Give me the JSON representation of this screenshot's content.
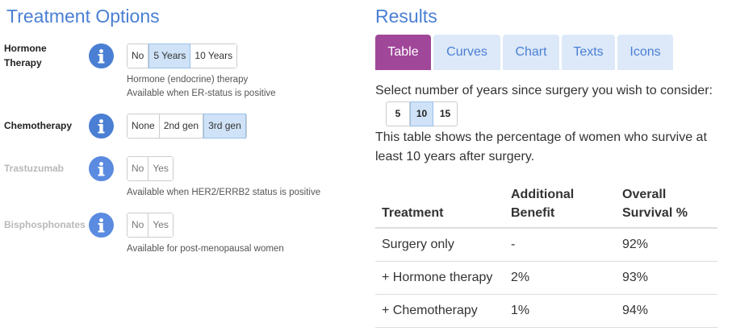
{
  "treatment_options": {
    "title": "Treatment Options",
    "rows": [
      {
        "label": "Hormone Therapy",
        "options": [
          "No",
          "5 Years",
          "10 Years"
        ],
        "selected": "5 Years",
        "note": [
          "Hormone (endocrine) therapy",
          "Available when ER-status is positive"
        ],
        "enabled": true
      },
      {
        "label": "Chemotherapy",
        "options": [
          "None",
          "2nd gen",
          "3rd gen"
        ],
        "selected": "3rd gen",
        "note": [],
        "enabled": true
      },
      {
        "label": "Trastuzumab",
        "options": [
          "No",
          "Yes"
        ],
        "selected": null,
        "note": [
          "Available when HER2/ERRB2 status is positive"
        ],
        "enabled": false
      },
      {
        "label": "Bisphosphonates",
        "options": [
          "No",
          "Yes"
        ],
        "selected": null,
        "note": [
          "Available for post-menopausal women"
        ],
        "enabled": false
      }
    ]
  },
  "results": {
    "title": "Results",
    "tabs": [
      "Table",
      "Curves",
      "Chart",
      "Texts",
      "Icons"
    ],
    "active_tab": "Table",
    "years_prompt": "Select number of years since surgery you wish to consider:",
    "years_options": [
      "5",
      "10",
      "15"
    ],
    "years_selected": "10",
    "description": "This table shows the percentage of women who survive at least 10 years after surgery.",
    "table": {
      "headers": [
        "Treatment",
        "Additional Benefit",
        "Overall Survival %"
      ],
      "rows": [
        [
          "Surgery only",
          "-",
          "92%"
        ],
        [
          "+ Hormone therapy",
          "2%",
          "93%"
        ],
        [
          "+ Chemotherapy",
          "1%",
          "94%"
        ]
      ]
    }
  },
  "icons": {
    "info": "info-icon"
  },
  "colors": {
    "accent": "#4a7fd4",
    "active_tab": "#a0479a",
    "tab_bg": "#dde9f8",
    "selected_option": "#cfe2f7"
  }
}
